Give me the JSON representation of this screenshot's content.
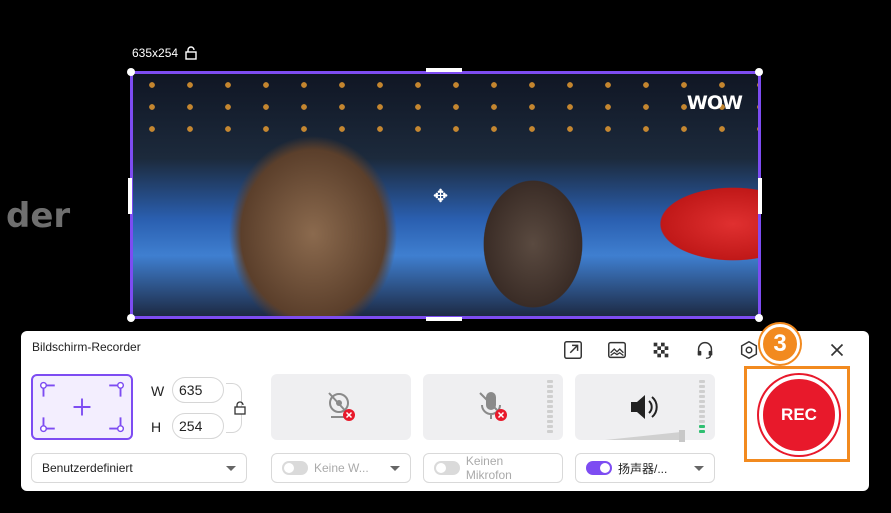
{
  "background": {
    "text": "der"
  },
  "capture": {
    "size_label": "635x254",
    "watermark": "WOW"
  },
  "panel": {
    "title": "Bildschirm-Recorder",
    "badge": "3",
    "width_label": "W",
    "height_label": "H",
    "width_value": "635",
    "height_value": "254",
    "mode_select": "Benutzerdefiniert",
    "webcam_select": "Keine W...",
    "mic_select": "Keinen Mikrofon",
    "speaker_select": "扬声器/...",
    "rec_label": "REC"
  },
  "colors": {
    "accent": "#7d4cf2",
    "rec": "#e8192b",
    "highlight": "#f28a1f"
  },
  "icons": [
    "export-icon",
    "screenshot-icon",
    "mosaic-icon",
    "support-icon",
    "settings-icon",
    "minimize-icon",
    "close-icon"
  ]
}
